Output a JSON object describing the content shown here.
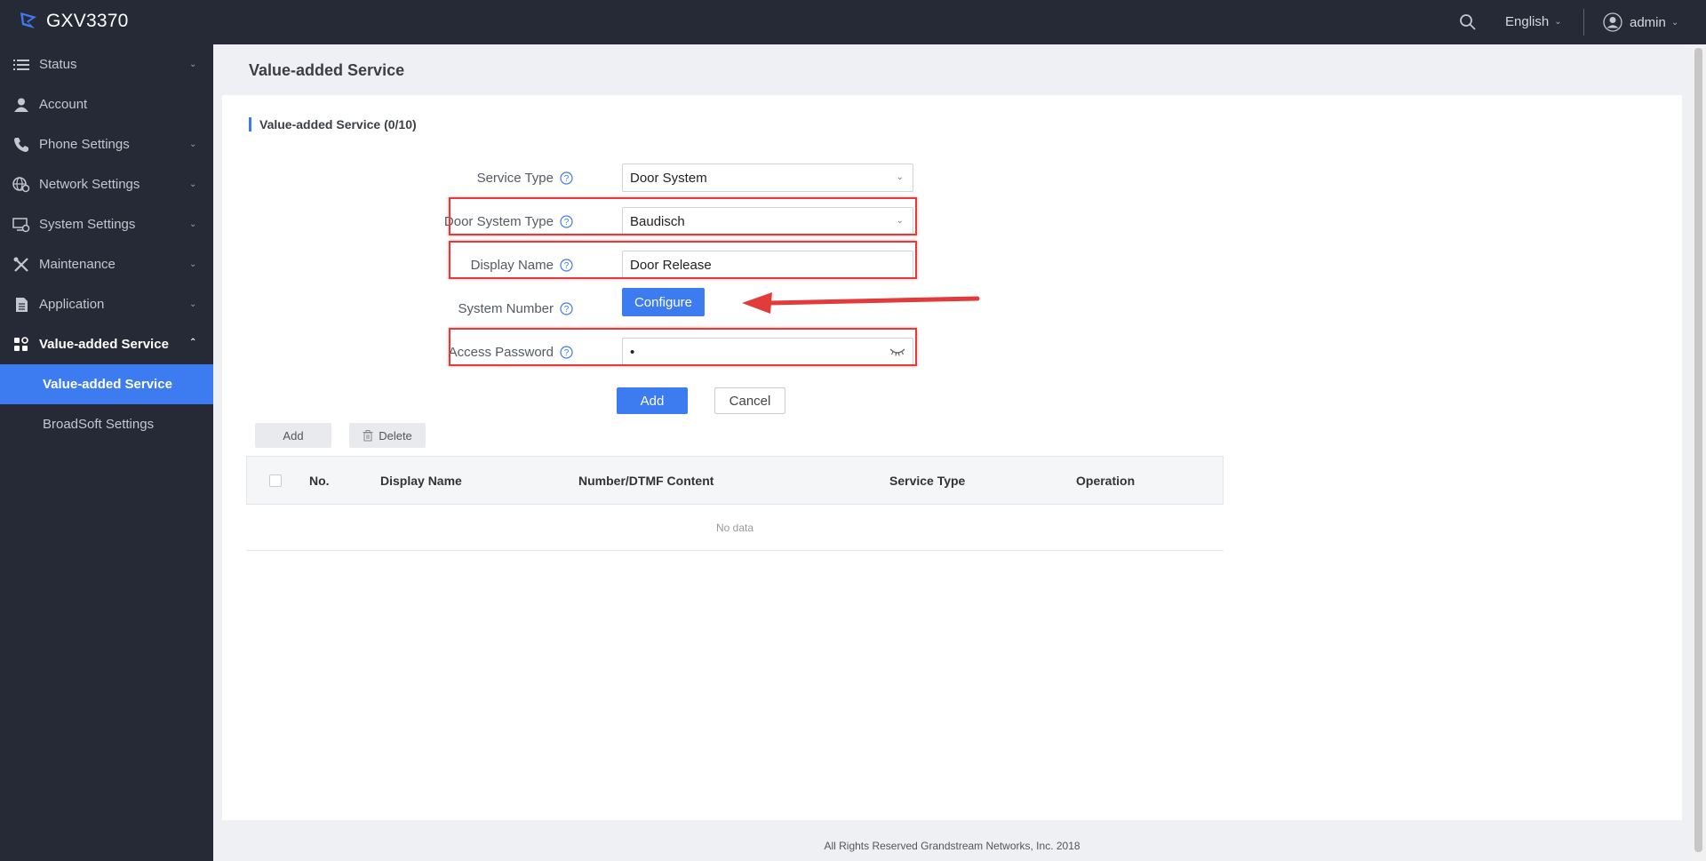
{
  "app": {
    "product": "GXV3370"
  },
  "header": {
    "language": "English",
    "user": "admin"
  },
  "sidebar": {
    "items": [
      {
        "label": "Status",
        "icon": "list-icon",
        "expandable": true
      },
      {
        "label": "Account",
        "icon": "user-icon",
        "expandable": false
      },
      {
        "label": "Phone Settings",
        "icon": "phone-icon",
        "expandable": true
      },
      {
        "label": "Network Settings",
        "icon": "network-icon",
        "expandable": true
      },
      {
        "label": "System Settings",
        "icon": "system-settings-icon",
        "expandable": true
      },
      {
        "label": "Maintenance",
        "icon": "tools-icon",
        "expandable": true
      },
      {
        "label": "Application",
        "icon": "document-icon",
        "expandable": true
      },
      {
        "label": "Value-added Service",
        "icon": "grid-icon",
        "expandable": true,
        "expanded": true
      }
    ],
    "subitems": [
      {
        "label": "Value-added Service",
        "selected": true
      },
      {
        "label": "BroadSoft Settings",
        "selected": false
      }
    ]
  },
  "page": {
    "title": "Value-added Service",
    "section_title": "Value-added Service (0/10)"
  },
  "form": {
    "service_type": {
      "label": "Service Type",
      "value": "Door System"
    },
    "door_system_type": {
      "label": "Door System Type",
      "value": "Baudisch"
    },
    "display_name": {
      "label": "Display Name",
      "value": "Door Release"
    },
    "system_number": {
      "label": "System Number",
      "button": "Configure"
    },
    "access_password": {
      "label": "Access Password",
      "value": "•"
    },
    "add_button": "Add",
    "cancel_button": "Cancel"
  },
  "table_toolbar": {
    "add": "Add",
    "delete": "Delete"
  },
  "table": {
    "columns": [
      "No.",
      "Display Name",
      "Number/DTMF Content",
      "Service Type",
      "Operation"
    ],
    "rows": [],
    "empty_text": "No data"
  },
  "footer": {
    "text": "All Rights Reserved Grandstream Networks, Inc. 2018"
  },
  "colors": {
    "primary": "#3c7bf0",
    "sidebar_bg": "#262a36",
    "highlight": "#e23b3b"
  }
}
